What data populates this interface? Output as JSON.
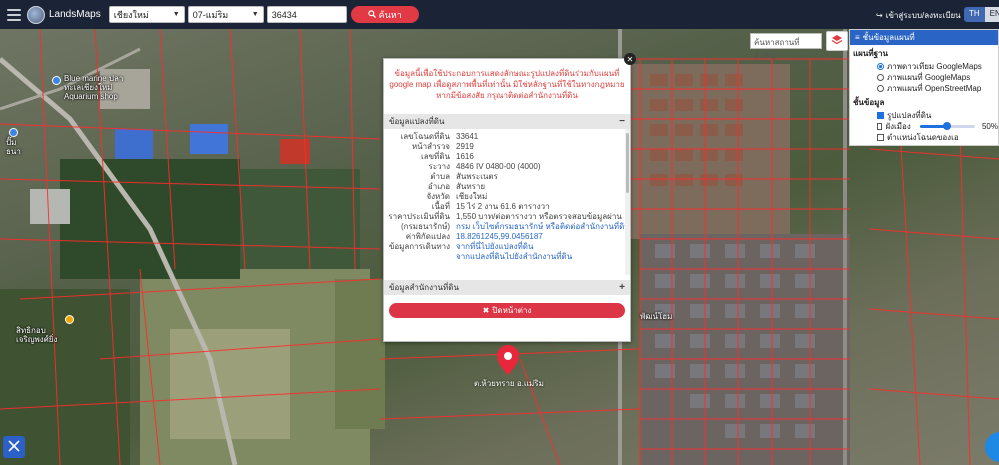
{
  "topbar": {
    "brand": "LandsMaps",
    "province": "เชียงใหม่",
    "district": "07-แม่ริม",
    "deed_number": "36434",
    "search_label": "ค้นหา",
    "login_label": "เข้าสู่ระบบ/ลงทะเบียน",
    "lang_active": "TH",
    "lang_other": "EN"
  },
  "map": {
    "search_placeholder": "ค้นหาสถานที่สำคัญ",
    "poi": [
      {
        "label": "Blue marine ปลา\nทะเลเชียงใหม่\nAquarium shop"
      },
      {
        "label": "ปั๊ม\nธนา"
      },
      {
        "label": "สิทธิกอบ\nเจริญพงศ์ยิ่ง"
      },
      {
        "label": "พัฒน์โฮม"
      }
    ],
    "pin_label": "ต.ห้วยทราย อ.แม่ริม"
  },
  "layer_panel": {
    "title": "ชั้นข้อมูลแผนที่",
    "basemap_heading": "แผนที่ฐาน",
    "basemaps": [
      {
        "label": "ภาพดาวเทียม GoogleMaps",
        "selected": true
      },
      {
        "label": "ภาพแผนที่ GoogleMaps",
        "selected": false
      },
      {
        "label": "ภาพแผนที่ OpenStreetMap",
        "selected": false
      }
    ],
    "data_heading": "ชั้นข้อมูล",
    "layers": [
      {
        "label": "รูปแปลงที่ดิน",
        "checked": true
      },
      {
        "label": "ผังเมือง",
        "checked": false,
        "opacity": 50,
        "opacity_label": "50%"
      },
      {
        "label": "ตำแหน่งโฉนดของเอ",
        "checked": false
      }
    ]
  },
  "popup": {
    "warning": "ข้อมูลนี้เพื่อใช้ประกอบการแสดงลักษณะรูปแปลงที่ดินร่วมกับแผนที่ google map เพื่อดูสภาพพื้นที่เท่านั้น มิใช่หลักฐานที่ใช้ในทางกฎหมาย หากมีข้อสงสัย กรุณาติดต่อสำนักงานที่ดิน",
    "parcel_section": "ข้อมูลแปลงที่ดิน",
    "parcel_fields": [
      {
        "key": "เลขโฉนดที่ดิน",
        "value": "33641"
      },
      {
        "key": "หน้าสำรวจ",
        "value": "2919"
      },
      {
        "key": "เลขที่ดิน",
        "value": "1616"
      },
      {
        "key": "ระวาง",
        "value": "4846 IV 0480-00 (4000)"
      },
      {
        "key": "ตำบล",
        "value": "สันพระเนตร"
      },
      {
        "key": "อำเภอ",
        "value": "สันทราย"
      },
      {
        "key": "จังหวัด",
        "value": "เชียงใหม่"
      },
      {
        "key": "เนื้อที่",
        "value": "15 ไร่ 2 งาน 61.6 ตารางวา"
      },
      {
        "key": "ราคาประเมินที่ดิน",
        "value": "1,550 บาท/ต่อตารางวา หรือตรวจสอบข้อมูลผ่าน"
      },
      {
        "key": "(กรมธนารักษ์)",
        "value": "กรม เว็บไซต์กรมธนารักษ์ หรือติดต่อสำนักงานที่ดิน"
      },
      {
        "key": "ค่าพิกัดแปลง",
        "value": "18.8261245,99.0456187"
      },
      {
        "key": "ข้อมูลการเดินทาง",
        "value": "จากที่นี่ไปยังแปลงที่ดิน"
      },
      {
        "key": "",
        "value": "จากแปลงที่ดินไปยังสำนักงานที่ดิน"
      }
    ],
    "office_section": "ข้อมูลสำนักงานที่ดิน",
    "close_label": "ปิดหน้าต่าง"
  }
}
